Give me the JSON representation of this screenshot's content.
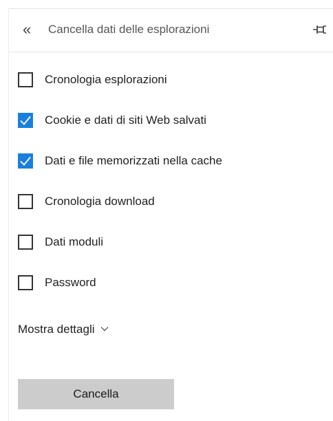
{
  "header": {
    "back_icon": "double-chevron-left-icon",
    "back_glyph": "«",
    "title": "Cancella dati delle esplorazioni",
    "pin_icon": "pin-icon"
  },
  "options": [
    {
      "label": "Cronologia esplorazioni",
      "checked": false
    },
    {
      "label": "Cookie e dati di siti Web salvati",
      "checked": true
    },
    {
      "label": "Dati e file memorizzati nella cache",
      "checked": true
    },
    {
      "label": "Cronologia download",
      "checked": false
    },
    {
      "label": "Dati moduli",
      "checked": false
    },
    {
      "label": "Password",
      "checked": false
    }
  ],
  "details": {
    "label": "Mostra dettagli",
    "icon": "chevron-down-icon"
  },
  "clear_button": {
    "label": "Cancella"
  },
  "colors": {
    "accent": "#1a7fdc",
    "button_bg": "#cccccc"
  }
}
